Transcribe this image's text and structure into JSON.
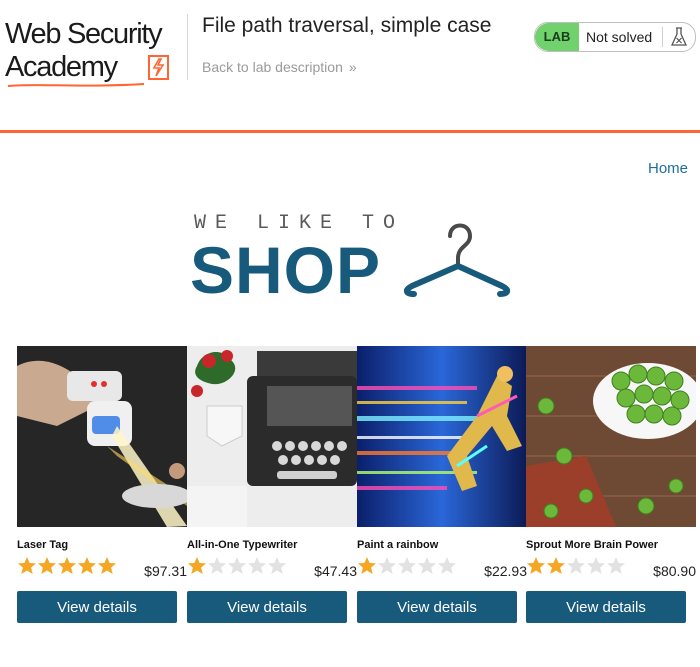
{
  "header": {
    "logo_line1": "Web Security",
    "logo_line2": "Academy",
    "lab_title": "File path traversal, simple case",
    "back_link": "Back to lab description",
    "back_chevron": "»",
    "lab_badge": "LAB",
    "status": "Not solved",
    "accent_color": "#ff6633"
  },
  "nav": {
    "home": "Home"
  },
  "hero": {
    "small": "WE LIKE TO",
    "big": "SHOP"
  },
  "colors": {
    "brand_blue": "#175a7c",
    "star_filled": "#f5a623",
    "star_empty": "#e2e2e2",
    "lab_green": "#70d16d"
  },
  "products": [
    {
      "name": "Laser Tag",
      "rating": 5,
      "price": "$97.31",
      "button": "View details",
      "image_icon": "laser-tag-image"
    },
    {
      "name": "All-in-One Typewriter",
      "rating": 1,
      "price": "$47.43",
      "button": "View details",
      "image_icon": "typewriter-image"
    },
    {
      "name": "Paint a rainbow",
      "rating": 1,
      "price": "$22.93",
      "button": "View details",
      "image_icon": "rainbow-runner-image"
    },
    {
      "name": "Sprout More Brain Power",
      "rating": 2,
      "price": "$80.90",
      "button": "View details",
      "image_icon": "sprouts-image"
    }
  ]
}
